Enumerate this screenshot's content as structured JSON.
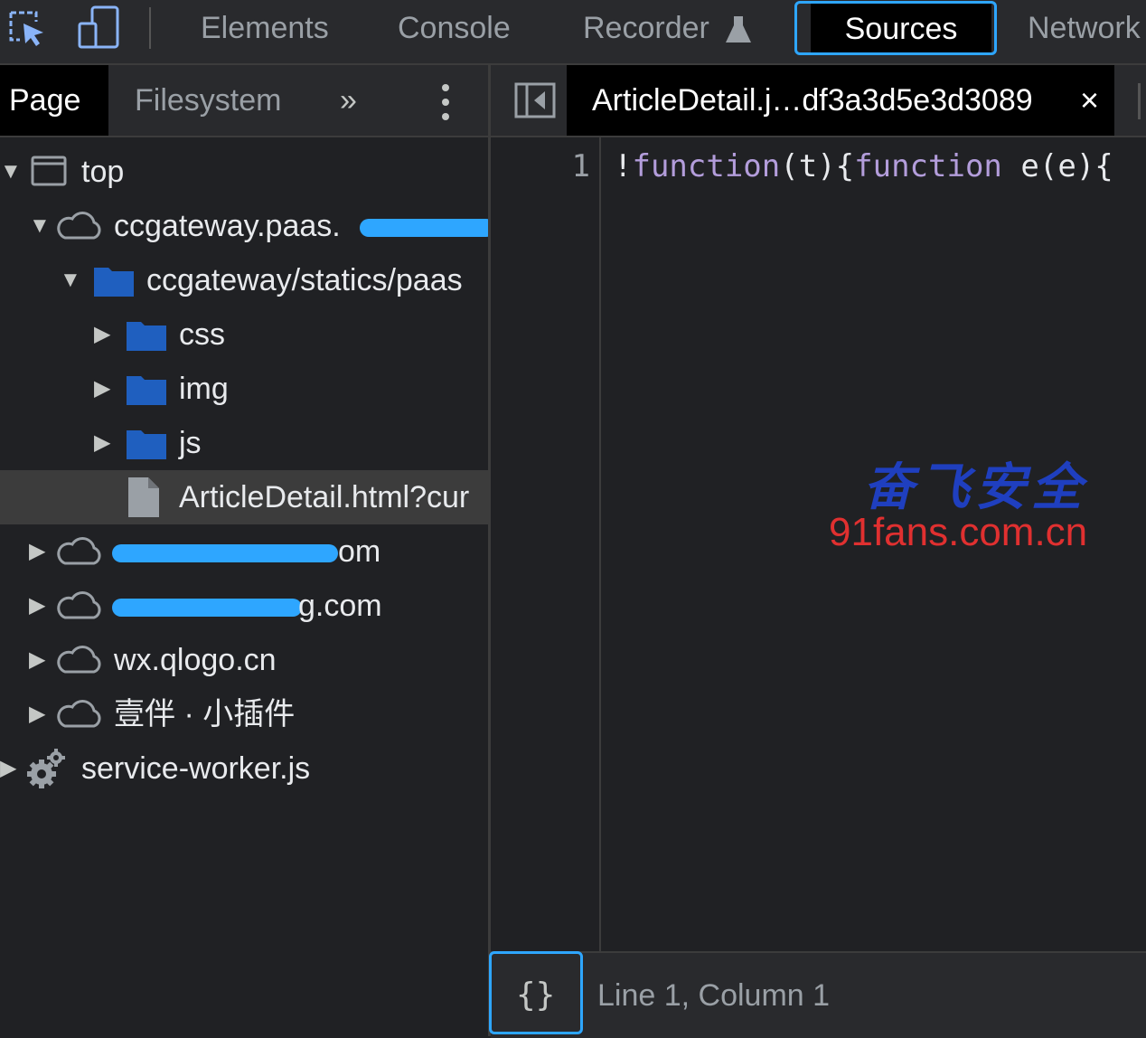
{
  "toolbar": {
    "tabs": [
      "Elements",
      "Console",
      "Recorder",
      "Sources",
      "Network"
    ],
    "active_tab": "Sources"
  },
  "navigator": {
    "tabs": [
      "Page",
      "Filesystem"
    ],
    "active_tab": "Page",
    "tree": [
      {
        "label": "top",
        "icon": "frame-icon",
        "expanded": true
      },
      {
        "label": "ccgateway.paas.",
        "icon": "cloud-icon",
        "expanded": true
      },
      {
        "label": "ccgateway/statics/paas",
        "icon": "folder-icon",
        "expanded": true
      },
      {
        "label": "css",
        "icon": "folder-icon",
        "expanded": false
      },
      {
        "label": "img",
        "icon": "folder-icon",
        "expanded": false
      },
      {
        "label": "js",
        "icon": "folder-icon",
        "expanded": false
      },
      {
        "label": "ArticleDetail.html?cur",
        "icon": "file-icon",
        "selected": true
      },
      {
        "label": "om",
        "icon": "cloud-icon",
        "expanded": false
      },
      {
        "label": "g.com",
        "icon": "cloud-icon",
        "expanded": false
      },
      {
        "label": "wx.qlogo.cn",
        "icon": "cloud-icon",
        "expanded": false
      },
      {
        "label": "壹伴 · 小插件",
        "icon": "cloud-icon",
        "expanded": false
      },
      {
        "label": "service-worker.js",
        "icon": "gear-icon",
        "expanded": false
      }
    ]
  },
  "editor": {
    "file_tab": "ArticleDetail.j…df3a3d5e3d3089",
    "close_glyph": "×",
    "line_number": "1",
    "code_tokens": {
      "bang": "!",
      "kw1": "function",
      "p1": "(t){",
      "kw2": "function",
      "p2": " e(e){"
    },
    "status": "Line 1, Column 1",
    "pretty_print": "{}"
  },
  "watermark": {
    "chinese": "奋飞安全",
    "site": "91fans.com.cn"
  },
  "colors": {
    "accent_outline": "#2ea6ff",
    "keyword": "#b39ddb",
    "folder": "#1f5fbf"
  }
}
